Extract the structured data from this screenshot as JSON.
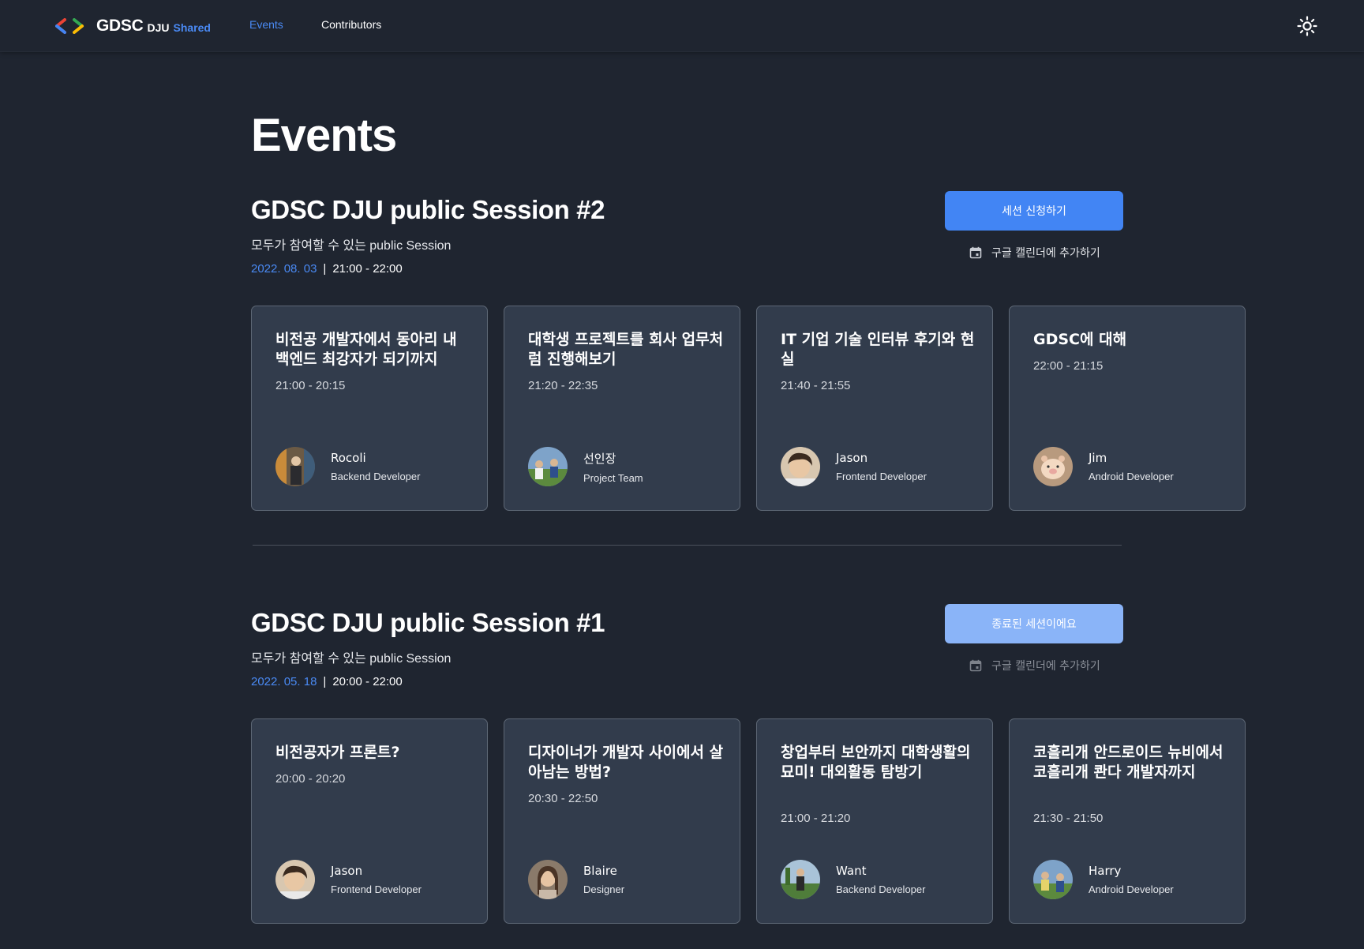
{
  "header": {
    "logo": {
      "brand": "GDSC",
      "org": "DJU",
      "tag": "Shared"
    },
    "nav": [
      {
        "label": "Events",
        "active": true
      },
      {
        "label": "Contributors",
        "active": false
      }
    ],
    "theme_icon": "sun-icon"
  },
  "page_title": "Events",
  "colors": {
    "background": "#1f2530",
    "accent": "#4285f4",
    "accent_disabled": "#8ab4f8",
    "card": "#323c4c",
    "date": "#4a8af4"
  },
  "sessions": [
    {
      "title": "GDSC DJU public Session #2",
      "description": "모두가 참여할 수 있는 public Session",
      "date": "2022. 08. 03",
      "separator": "|",
      "time": "21:00 - 22:00",
      "button_label": "세션 신청하기",
      "button_state": "open",
      "calendar_label": "구글 캘린더에 추가하기",
      "calendar_icon": "calendar-icon",
      "talks": [
        {
          "title": "비전공 개발자에서 동아리 내 백엔드 최강자가 되기까지",
          "time": "21:00 - 20:15",
          "speaker": "Rocoli",
          "role": "Backend Developer",
          "avatar": "avatar-rocoli"
        },
        {
          "title": "대학생 프로젝트를 회사 업무처럼 진행해보기",
          "time": "21:20 - 22:35",
          "speaker": "선인장",
          "role": "Project Team",
          "avatar": "avatar-seoninjang"
        },
        {
          "title": "IT 기업 기술 인터뷰 후기와 현실",
          "time": "21:40 - 21:55",
          "speaker": "Jason",
          "role": "Frontend Developer",
          "avatar": "avatar-jason"
        },
        {
          "title": "GDSC에 대해",
          "time": "22:00 - 21:15",
          "speaker": "Jim",
          "role": "Android Developer",
          "avatar": "avatar-jim"
        }
      ]
    },
    {
      "title": "GDSC DJU public Session #1",
      "description": "모두가 참여할 수 있는 public Session",
      "date": "2022. 05. 18",
      "separator": "|",
      "time": "20:00 - 22:00",
      "button_label": "종료된 세션이에요",
      "button_state": "ended",
      "calendar_label": "구글 캘린더에 추가하기",
      "calendar_icon": "calendar-icon",
      "talks": [
        {
          "title": "비전공자가 프론트?",
          "time": "20:00 - 20:20",
          "speaker": "Jason",
          "role": "Frontend Developer",
          "avatar": "avatar-jason"
        },
        {
          "title": "디자이너가 개발자 사이에서 살아남는 방법?",
          "time": "20:30 - 22:50",
          "speaker": "Blaire",
          "role": "Designer",
          "avatar": "avatar-blaire"
        },
        {
          "title": "창업부터 보안까지 대학생활의 묘미! 대외활동 탐방기",
          "time": "21:00 - 21:20",
          "speaker": "Want",
          "role": "Backend Developer",
          "avatar": "avatar-want"
        },
        {
          "title": "코흘리개 안드로이드 뉴비에서 코흘리개 콴다 개발자까지",
          "time": "21:30 - 21:50",
          "speaker": "Harry",
          "role": "Android Developer",
          "avatar": "avatar-harry"
        }
      ]
    }
  ]
}
